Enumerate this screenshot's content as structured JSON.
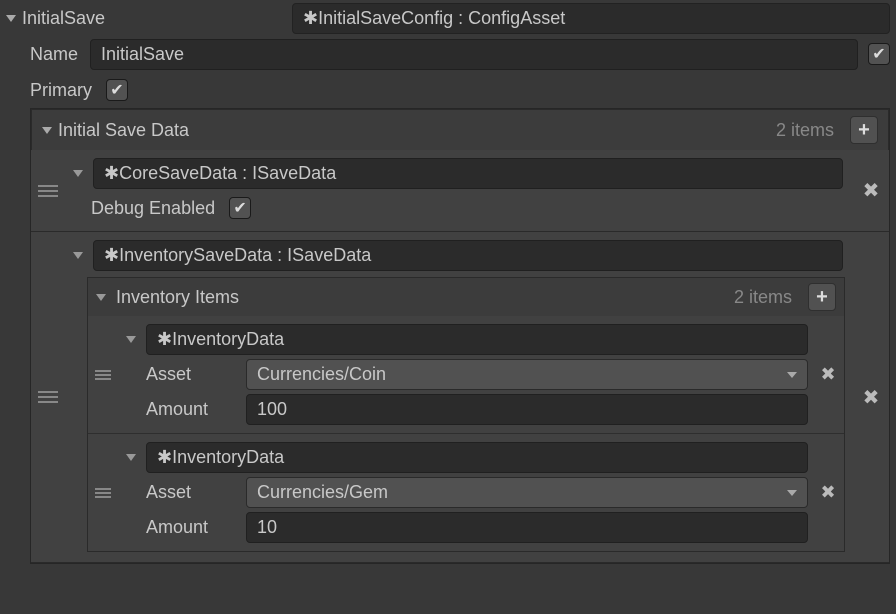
{
  "header": {
    "title": "InitialSave",
    "type_text": "✱InitialSaveConfig : ConfigAsset"
  },
  "name_label": "Name",
  "name_value": "InitialSave",
  "name_checked": true,
  "primary_label": "Primary",
  "primary_checked": true,
  "save_list": {
    "title": "Initial Save Data",
    "count_text": "2 items"
  },
  "core": {
    "type_text": "✱CoreSaveData : ISaveData",
    "debug_label": "Debug Enabled",
    "debug_checked": true
  },
  "inventory": {
    "type_text": "✱InventorySaveData : ISaveData",
    "items_title": "Inventory Items",
    "items_count": "2 items",
    "rows": [
      {
        "type_text": "✱InventoryData",
        "asset_label": "Asset",
        "asset_value": "Currencies/Coin",
        "amount_label": "Amount",
        "amount_value": "100"
      },
      {
        "type_text": "✱InventoryData",
        "asset_label": "Asset",
        "asset_value": "Currencies/Gem",
        "amount_label": "Amount",
        "amount_value": "10"
      }
    ]
  }
}
